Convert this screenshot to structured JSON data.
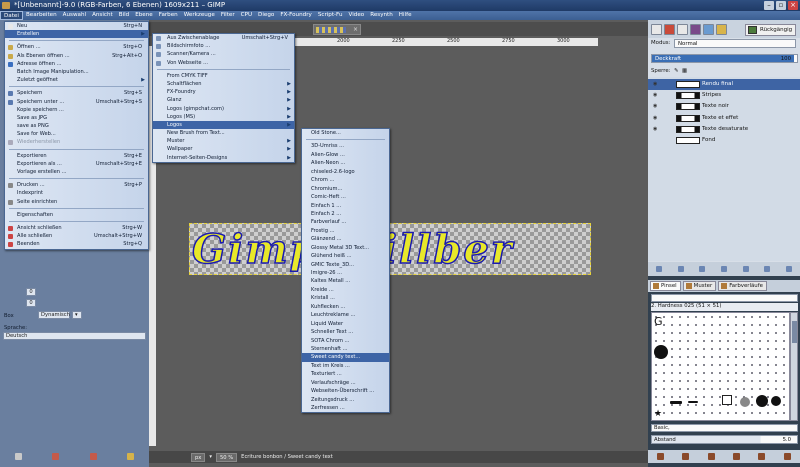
{
  "window": {
    "title": "*[Unbenannt]-9.0 (RGB-Farben, 6 Ebenen) 1609x211 – GIMP"
  },
  "menubar": [
    "Datei",
    "Bearbeiten",
    "Auswahl",
    "Ansicht",
    "Bild",
    "Ebene",
    "Farben",
    "Werkzeuge",
    "Filter",
    "CPU",
    "Diego",
    "FX-Foundry",
    "Script-Fu",
    "Video",
    "Resynth",
    "Hilfe"
  ],
  "file_menu": {
    "items": [
      {
        "label": "Neu",
        "shortcut": "Strg+N"
      },
      {
        "label": "Erstellen",
        "shortcut": ""
      },
      {
        "label": "Öffnen ...",
        "shortcut": "Strg+O"
      },
      {
        "label": "Als Ebenen öffnen ...",
        "shortcut": "Strg+Alt+O"
      },
      {
        "label": "Adresse öffnen ...",
        "shortcut": ""
      },
      {
        "label": "Batch Image Manipulation...",
        "shortcut": ""
      },
      {
        "label": "Zuletzt geöffnet",
        "shortcut": ""
      },
      {
        "label": "Speichern",
        "shortcut": "Strg+S"
      },
      {
        "label": "Speichern unter ...",
        "shortcut": "Umschalt+Strg+S"
      },
      {
        "label": "Kopie speichern ...",
        "shortcut": ""
      },
      {
        "label": "Save as JPG",
        "shortcut": ""
      },
      {
        "label": "save as PNG",
        "shortcut": ""
      },
      {
        "label": "Save for Web...",
        "shortcut": ""
      },
      {
        "label": "Wiederherstellen",
        "shortcut": ""
      },
      {
        "label": "Exportieren",
        "shortcut": "Strg+E"
      },
      {
        "label": "Exportieren als ...",
        "shortcut": "Umschalt+Strg+E"
      },
      {
        "label": "Vorlage erstellen ...",
        "shortcut": ""
      },
      {
        "label": "Drucken ...",
        "shortcut": "Strg+P"
      },
      {
        "label": "Indexprint",
        "shortcut": ""
      },
      {
        "label": "Seite einrichten",
        "shortcut": ""
      },
      {
        "label": "Eigenschaften",
        "shortcut": ""
      },
      {
        "label": "Ansicht schließen",
        "shortcut": "Strg+W"
      },
      {
        "label": "Alle schließen",
        "shortcut": "Umschalt+Strg+W"
      },
      {
        "label": "Beenden",
        "shortcut": "Strg+Q"
      }
    ]
  },
  "create_menu": {
    "items": [
      {
        "label": "Aus Zwischenablage",
        "shortcut": "Umschalt+Strg+V"
      },
      {
        "label": "Bildschirmfoto ...",
        "shortcut": ""
      },
      {
        "label": "Scanner/Kamera ...",
        "shortcut": ""
      },
      {
        "label": "Von Webseite ...",
        "shortcut": ""
      },
      {
        "label": "From CMYK TIFF",
        "shortcut": ""
      },
      {
        "label": "Schaltflächen",
        "shortcut": ""
      },
      {
        "label": "FX-Foundry",
        "shortcut": ""
      },
      {
        "label": "Glanz",
        "shortcut": ""
      },
      {
        "label": "Logos (gimpchat.com)",
        "shortcut": ""
      },
      {
        "label": "Logos (MS)",
        "shortcut": ""
      },
      {
        "label": "Logos",
        "shortcut": ""
      },
      {
        "label": "New Brush from Text...",
        "shortcut": ""
      },
      {
        "label": "Muster",
        "shortcut": ""
      },
      {
        "label": "Wallpaper",
        "shortcut": ""
      },
      {
        "label": "Internet-Seiten-Designs",
        "shortcut": ""
      }
    ]
  },
  "logos_menu": {
    "items": [
      "Old Stone...",
      "3D-Umriss ...",
      "Alien-Glow ...",
      "Alien-Neon ...",
      "chiseled-2.6-logo",
      "Chrom ...",
      "Chromium...",
      "Comic-Heft ...",
      "Einfach 1 ...",
      "Einfach 2 ...",
      "Farbverlauf ...",
      "Frostig ...",
      "Glänzend ...",
      "Glossy Metal 3D Text...",
      "Glühend heiß ...",
      "GMIC Texte_3D...",
      "Imigre-26 ...",
      "Kaltes Metall ...",
      "Kreide ...",
      "Kristall ...",
      "Kuhflecken ...",
      "Leuchtreklame ...",
      "Liquid Water",
      "Schneller Text ...",
      "SOTA Chrom ...",
      "Sternenhaft ...",
      "Sweet candy text...",
      "Text im Kreis ...",
      "Texturiert ...",
      "Verlaufschräge ...",
      "Webseiten-Überschrift ...",
      "Zeitungsdruck ...",
      "Zerfressen ..."
    ]
  },
  "ruler": {
    "ticks": [
      "1250",
      "1500",
      "1750",
      "2000",
      "2250",
      "2500",
      "2750",
      "3000"
    ]
  },
  "canvas": {
    "text": "Gimp Willber"
  },
  "status": {
    "unit": "px",
    "zoom": "50 %",
    "message": "Ecriture bonbon / Sweet candy text"
  },
  "tool_options": {
    "box_label": "Box",
    "box_value": "Dynamisch",
    "language_label": "Sprache:",
    "language_value": "Deutsch"
  },
  "right_dock": {
    "undo_tab": "Rückgängig",
    "mode_label": "Modus:",
    "mode_value": "Normal",
    "opacity_label": "Deckkraft",
    "opacity_value": "100",
    "lock_label": "Sperre:",
    "layers": [
      {
        "name": "Rendu final",
        "selected": true
      },
      {
        "name": "Stripes",
        "selected": false
      },
      {
        "name": "Texte noir",
        "selected": false
      },
      {
        "name": "Texte et effet",
        "selected": false
      },
      {
        "name": "Texte desaturate",
        "selected": false
      },
      {
        "name": "Fond",
        "selected": false
      }
    ],
    "brush_tabs": [
      "Pinsel",
      "Muster",
      "Farbverläufe"
    ],
    "brush_name": "2. Hardness 025 (51 × 51)",
    "brush_set": "Basic,",
    "spacing_label": "Abstand",
    "spacing_value": "5.0"
  },
  "colors": {
    "accent": "#3d64a6",
    "menubar": "#4f73a8",
    "canvas_bg": "#5c5c5c",
    "text_fill": "#e8e82a",
    "text_stroke": "#1a1ab0"
  }
}
